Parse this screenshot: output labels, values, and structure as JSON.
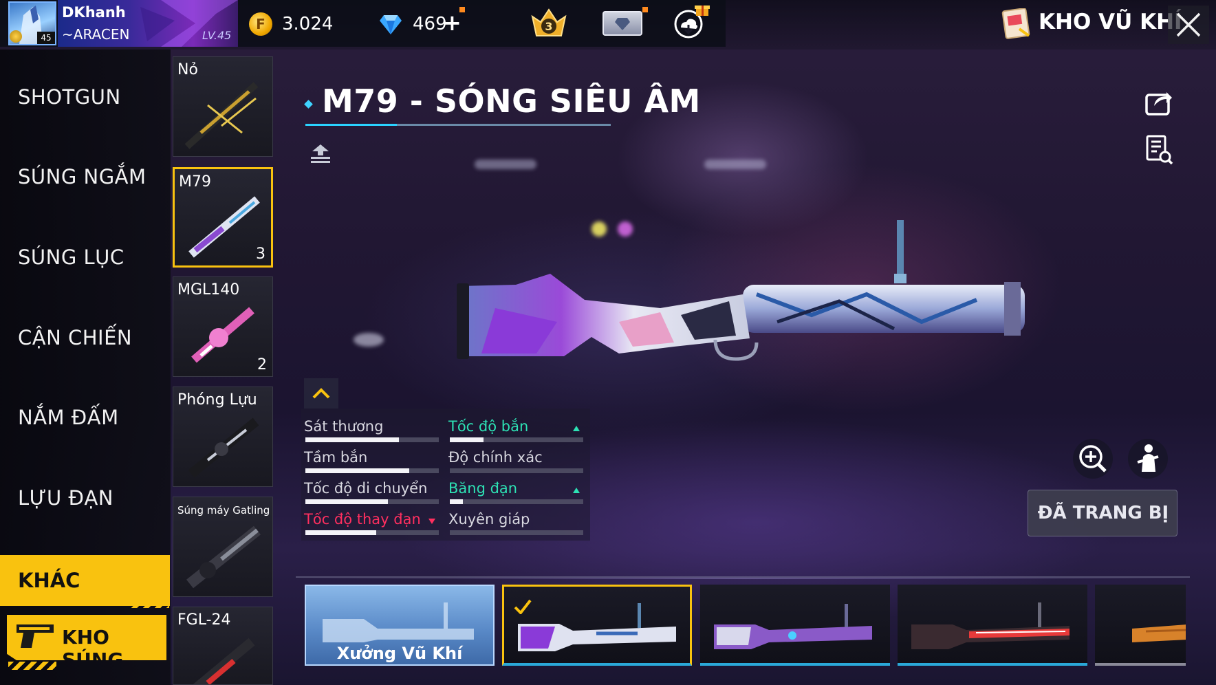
{
  "player": {
    "name": "DKhanh",
    "tag": "~ARACEN",
    "level_label": "LV.45",
    "avatar_level": "45"
  },
  "currency": {
    "gold": "3.024",
    "diamonds": "469",
    "add": "+",
    "coin_glyph": "F"
  },
  "rank_number": "3",
  "header": {
    "title": "KHO VŨ KHÍ"
  },
  "categories": [
    {
      "label": "SHOTGUN"
    },
    {
      "label": "SÚNG NGẮM"
    },
    {
      "label": "SÚNG LỤC"
    },
    {
      "label": "CẬN CHIẾN"
    },
    {
      "label": "NẮM ĐẤM"
    },
    {
      "label": "LỰU ĐẠN"
    }
  ],
  "active_category": "KHÁC",
  "kho_sung": "KHO SÚNG",
  "weapon_types": [
    {
      "label": "Nỏ",
      "count": ""
    },
    {
      "label": "M79",
      "count": "3"
    },
    {
      "label": "MGL140",
      "count": "2"
    },
    {
      "label": "Phóng Lựu",
      "count": ""
    },
    {
      "label": "Súng máy Gatling",
      "count": ""
    },
    {
      "label": "FGL-24",
      "count": ""
    }
  ],
  "weapon": {
    "title": "M79 - SÓNG SIÊU ÂM"
  },
  "stats": [
    {
      "label": "Sát thương",
      "value": 0.7,
      "trend": "none"
    },
    {
      "label": "Tốc độ bắn",
      "value": 0.25,
      "trend": "up"
    },
    {
      "label": "Tầm bắn",
      "value": 0.78,
      "trend": "none"
    },
    {
      "label": "Độ chính xác",
      "value": 0.0,
      "trend": "none"
    },
    {
      "label": "Tốc độ di chuyển",
      "value": 0.62,
      "trend": "none"
    },
    {
      "label": "Băng đạn",
      "value": 0.1,
      "trend": "up"
    },
    {
      "label": "Tốc độ thay đạn",
      "value": 0.53,
      "trend": "down"
    },
    {
      "label": "Xuyên giáp",
      "value": 0.0,
      "trend": "none"
    }
  ],
  "equipped_label": "ĐÃ TRANG BỊ",
  "skins": [
    {
      "label": "Xưởng Vũ Khí"
    }
  ],
  "colors": {
    "accent_yellow": "#f9c20f",
    "accent_cyan": "#2ad2ff",
    "stat_up": "#2de1b4",
    "stat_down": "#ff2f5f"
  }
}
